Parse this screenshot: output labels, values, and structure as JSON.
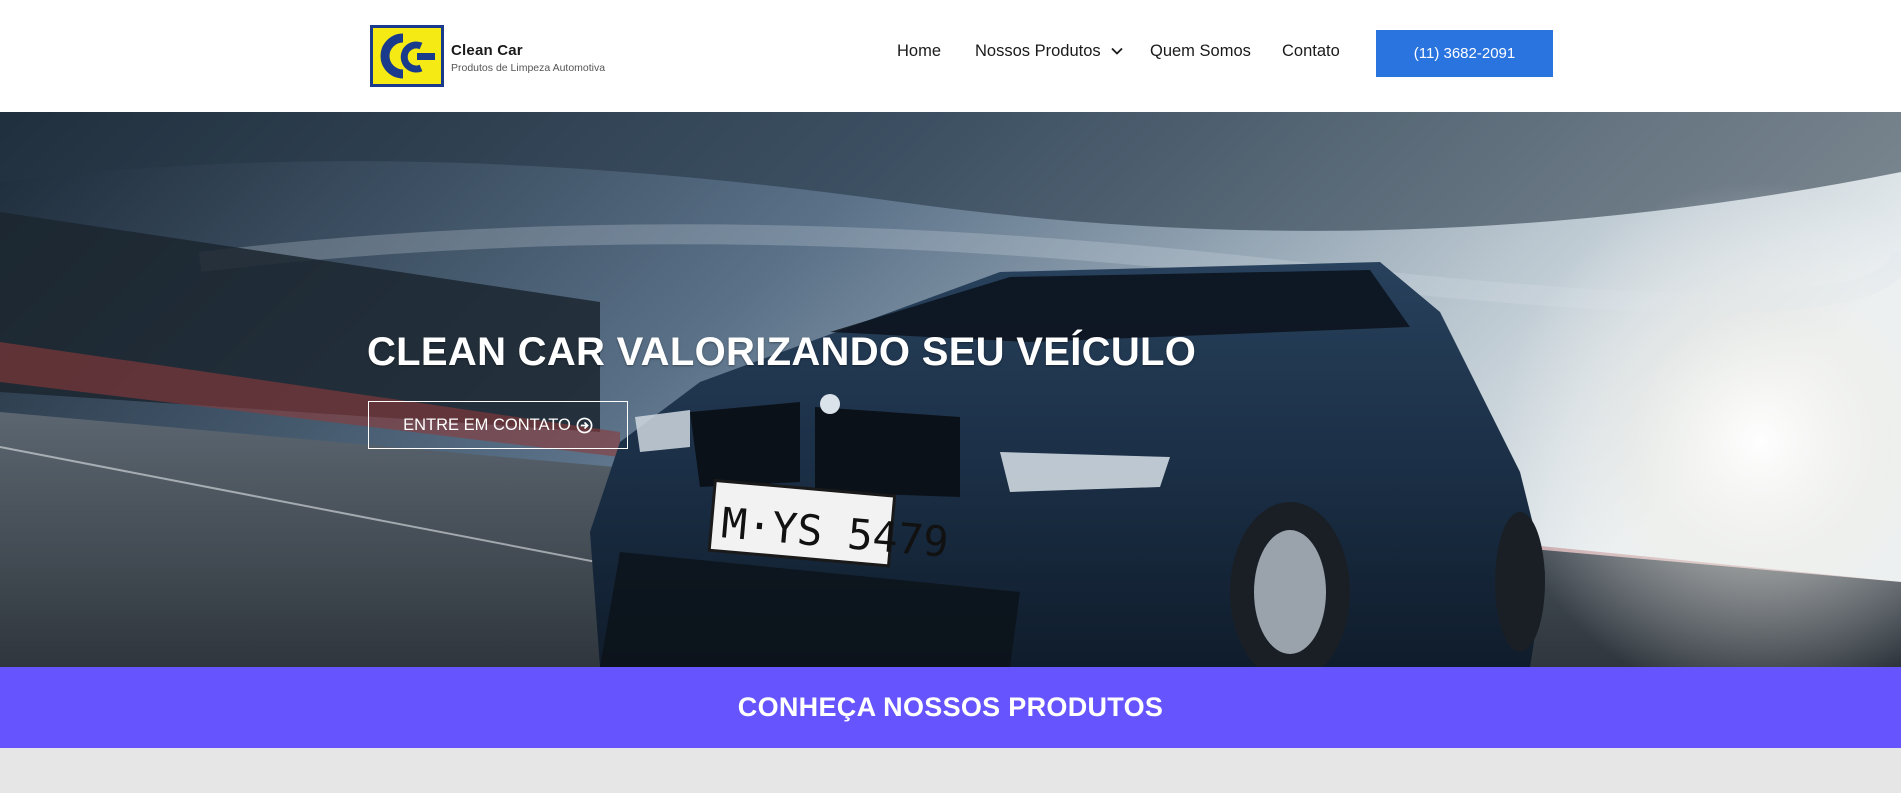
{
  "brand": {
    "name": "Clean Car",
    "tagline": "Produtos de Limpeza Automotiva",
    "logo_icon": "cc-logo-icon",
    "colors": {
      "logo_yellow": "#f5ea14",
      "logo_blue": "#1a3a8c"
    }
  },
  "nav": {
    "items": [
      {
        "label": "Home"
      },
      {
        "label": "Nossos Produtos",
        "icon": "chevron-down-icon"
      },
      {
        "label": "Quem Somos"
      },
      {
        "label": "Contato"
      }
    ],
    "phone_button": "(11) 3682-2091"
  },
  "hero": {
    "title": "CLEAN CAR VALORIZANDO SEU VEÍCULO",
    "cta_label": "ENTRE EM CONTATO",
    "cta_icon": "arrow-circle-right-icon",
    "plate_text": "M·YS 5479"
  },
  "section": {
    "title": "CONHEÇA NOSSOS PRODUTOS"
  },
  "colors": {
    "accent_blue": "#2a74e0",
    "band_purple": "#6655ff",
    "page_gray": "#e6e6e6"
  }
}
